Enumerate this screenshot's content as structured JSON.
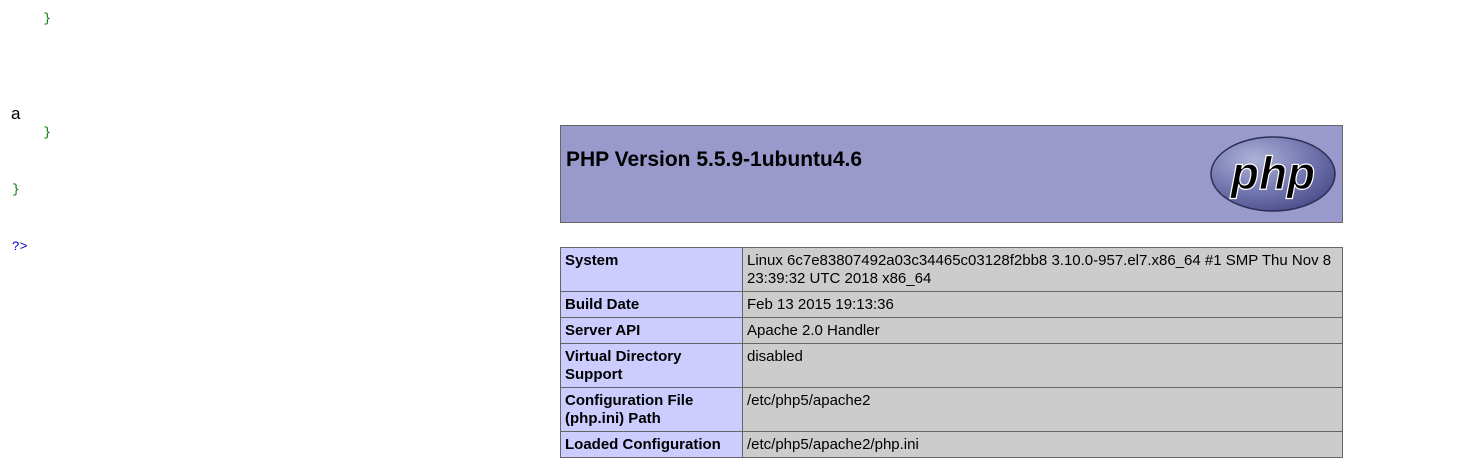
{
  "code_snippet": {
    "lines": [
      {
        "text": "    }",
        "kind": "brace"
      },
      {
        "text": "",
        "kind": "blank"
      },
      {
        "text": "    }",
        "kind": "brace"
      },
      {
        "text": "}",
        "kind": "brace"
      },
      {
        "text": "?>",
        "kind": "tag"
      }
    ]
  },
  "output_text": "a",
  "phpinfo": {
    "title": "PHP Version 5.5.9-1ubuntu4.6",
    "logo_text": "php",
    "colors": {
      "header_bg": "#9999cc",
      "key_bg": "#ccccff",
      "value_bg": "#cccccc",
      "border": "#666666"
    },
    "rows": [
      {
        "key": "System",
        "value": "Linux 6c7e83807492a03c34465c03128f2bb8 3.10.0-957.el7.x86_64 #1 SMP Thu Nov 8 23:39:32 UTC 2018 x86_64"
      },
      {
        "key": "Build Date",
        "value": "Feb 13 2015 19:13:36"
      },
      {
        "key": "Server API",
        "value": "Apache 2.0 Handler"
      },
      {
        "key": "Virtual Directory Support",
        "value": "disabled"
      },
      {
        "key": "Configuration File (php.ini) Path",
        "value": "/etc/php5/apache2"
      },
      {
        "key": "Loaded Configuration",
        "value": "/etc/php5/apache2/php.ini"
      }
    ]
  }
}
